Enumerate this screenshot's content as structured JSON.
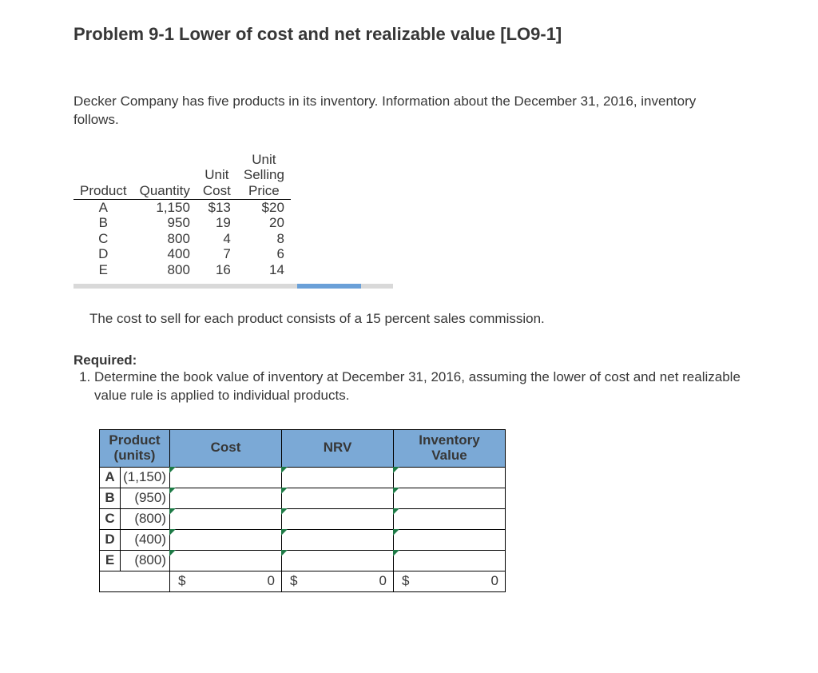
{
  "title": "Problem 9-1 Lower of cost and net realizable value [LO9-1]",
  "intro": "Decker Company has five products in its inventory. Information about the December 31, 2016, inventory follows.",
  "info_headers": {
    "product": "Product",
    "quantity": "Quantity",
    "unit_cost_line1": "Unit",
    "unit_cost_line2": "Cost",
    "usp_line1": "Unit",
    "usp_line2": "Selling",
    "usp_line3": "Price"
  },
  "info_rows": [
    {
      "product": "A",
      "quantity": "1,150",
      "cost": "$13",
      "price": "$20"
    },
    {
      "product": "B",
      "quantity": "950",
      "cost": "19",
      "price": "20"
    },
    {
      "product": "C",
      "quantity": "800",
      "cost": "4",
      "price": "8"
    },
    {
      "product": "D",
      "quantity": "400",
      "cost": "7",
      "price": "6"
    },
    {
      "product": "E",
      "quantity": "800",
      "cost": "16",
      "price": "14"
    }
  ],
  "note": "The cost to sell for each product consists of a 15 percent sales commission.",
  "required_label": "Required:",
  "requirement_1": "Determine the book value of inventory at December 31, 2016, assuming the lower of cost and net realizable value rule is applied to individual products.",
  "input_headers": {
    "product_line1": "Product",
    "product_line2": "(units)",
    "cost": "Cost",
    "nrv": "NRV",
    "inv_line1": "Inventory",
    "inv_line2": "Value"
  },
  "input_rows": [
    {
      "letter": "A",
      "units": "(1,150)"
    },
    {
      "letter": "B",
      "units": "(950)"
    },
    {
      "letter": "C",
      "units": "(800)"
    },
    {
      "letter": "D",
      "units": "(400)"
    },
    {
      "letter": "E",
      "units": "(800)"
    }
  ],
  "totals": {
    "sym": "$",
    "cost": "0",
    "nrv": "0",
    "inv": "0"
  }
}
